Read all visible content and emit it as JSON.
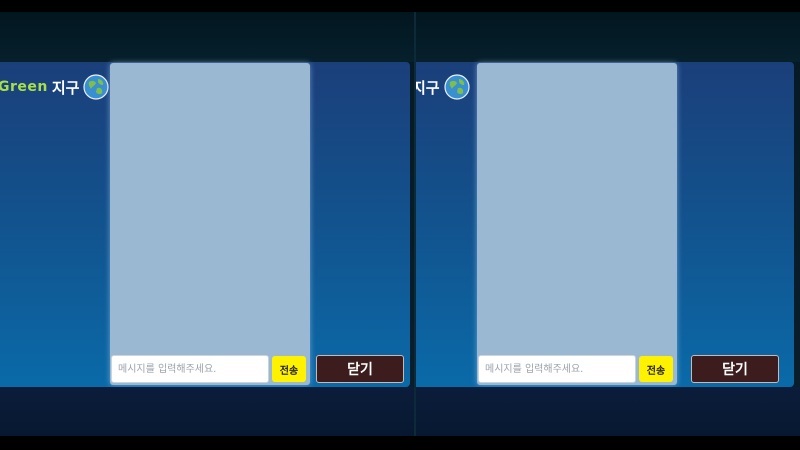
{
  "brand": {
    "green_text": "Green",
    "earth_text": "지구",
    "earth_icon": "earth-globe-icon"
  },
  "chat": {
    "input_placeholder": "메시지를 입력해주세요.",
    "input_value": "",
    "send_label": "전송",
    "close_label": "닫기"
  },
  "colors": {
    "accent_green": "#a6e04a",
    "send_button": "#fff200",
    "close_button": "#3c1c1d",
    "chat_panel": "#9bb8d3"
  }
}
